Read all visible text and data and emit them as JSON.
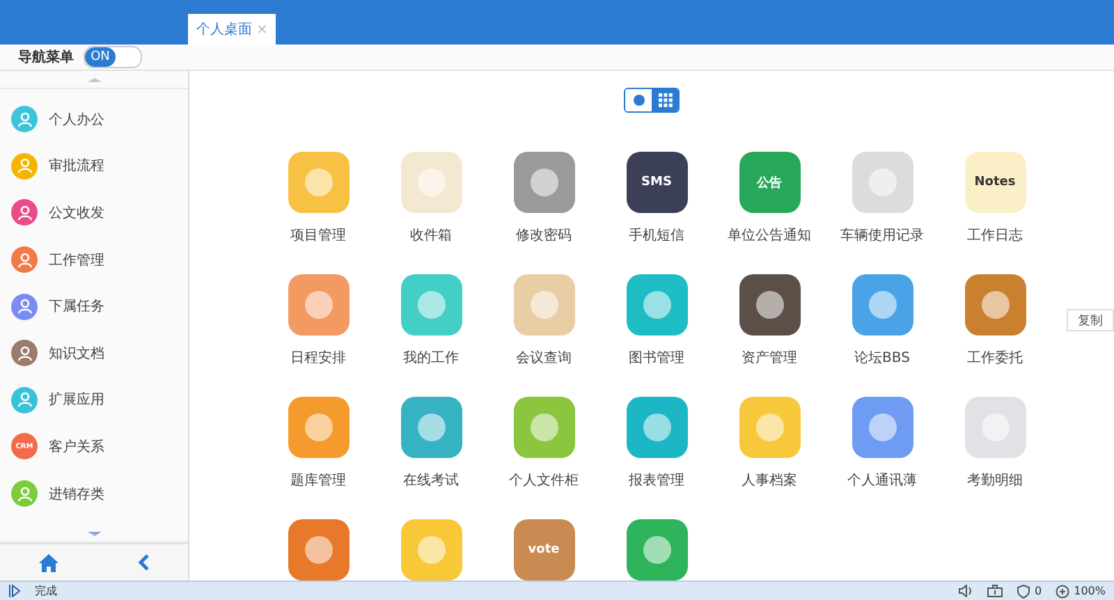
{
  "tabs": [
    {
      "label": "个人桌面",
      "close": "×",
      "selected": true
    }
  ],
  "nav_toggle": {
    "label": "导航菜单",
    "state_text": "ON",
    "on": true
  },
  "sidebar": {
    "items": [
      {
        "label": "个人办公",
        "color": "#3cc4dd"
      },
      {
        "label": "审批流程",
        "color": "#f5b400"
      },
      {
        "label": "公文收发",
        "color": "#ea4c89"
      },
      {
        "label": "工作管理",
        "color": "#f2794a"
      },
      {
        "label": "下属任务",
        "color": "#7b8cf0"
      },
      {
        "label": "知识文档",
        "color": "#9a7b6c"
      },
      {
        "label": "扩展应用",
        "color": "#38c3d8"
      },
      {
        "label": "客户关系",
        "color": "#f26b4a",
        "icon_text": "CRM"
      },
      {
        "label": "进销存类",
        "color": "#7ccc3c"
      }
    ]
  },
  "copy_button": "复制",
  "view_modes": [
    {
      "kind": "dot",
      "selected": false
    },
    {
      "kind": "grid",
      "selected": true
    }
  ],
  "apps": [
    {
      "label": "项目管理",
      "color": "#f7c244"
    },
    {
      "label": "收件箱",
      "color": "#f3e9d2"
    },
    {
      "label": "修改密码",
      "color": "#9a9a9a"
    },
    {
      "label": "手机短信",
      "color": "#3b3f57",
      "icon_text": "SMS"
    },
    {
      "label": "单位公告通知",
      "color": "#27a85a",
      "icon_text": "公告"
    },
    {
      "label": "车辆使用记录",
      "color": "#dcdcdc"
    },
    {
      "label": "工作日志",
      "color": "#fbefc8",
      "icon_text": "Notes"
    },
    {
      "label": "日程安排",
      "color": "#f39a63"
    },
    {
      "label": "我的工作",
      "color": "#43cfc6"
    },
    {
      "label": "会议查询",
      "color": "#e8cda5"
    },
    {
      "label": "图书管理",
      "color": "#1ebdc4"
    },
    {
      "label": "资产管理",
      "color": "#5b4f48"
    },
    {
      "label": "论坛BBS",
      "color": "#4aa3e6"
    },
    {
      "label": "工作委托",
      "color": "#c9802f"
    },
    {
      "label": "题库管理",
      "color": "#f59a2c"
    },
    {
      "label": "在线考试",
      "color": "#35b3c2"
    },
    {
      "label": "个人文件柜",
      "color": "#8cc63f"
    },
    {
      "label": "报表管理",
      "color": "#1cb7c4"
    },
    {
      "label": "人事档案",
      "color": "#f8c83c"
    },
    {
      "label": "个人通讯薄",
      "color": "#6e9cf2"
    },
    {
      "label": "考勤明细",
      "color": "#e2e2e6"
    },
    {
      "color": "#e8782a"
    },
    {
      "color": "#f8c838"
    },
    {
      "color": "#c98b52",
      "icon_text": "vote"
    },
    {
      "color": "#2eb45a"
    }
  ],
  "status_bar": {
    "left": "完成",
    "counter": "0",
    "zoom": "100%"
  }
}
